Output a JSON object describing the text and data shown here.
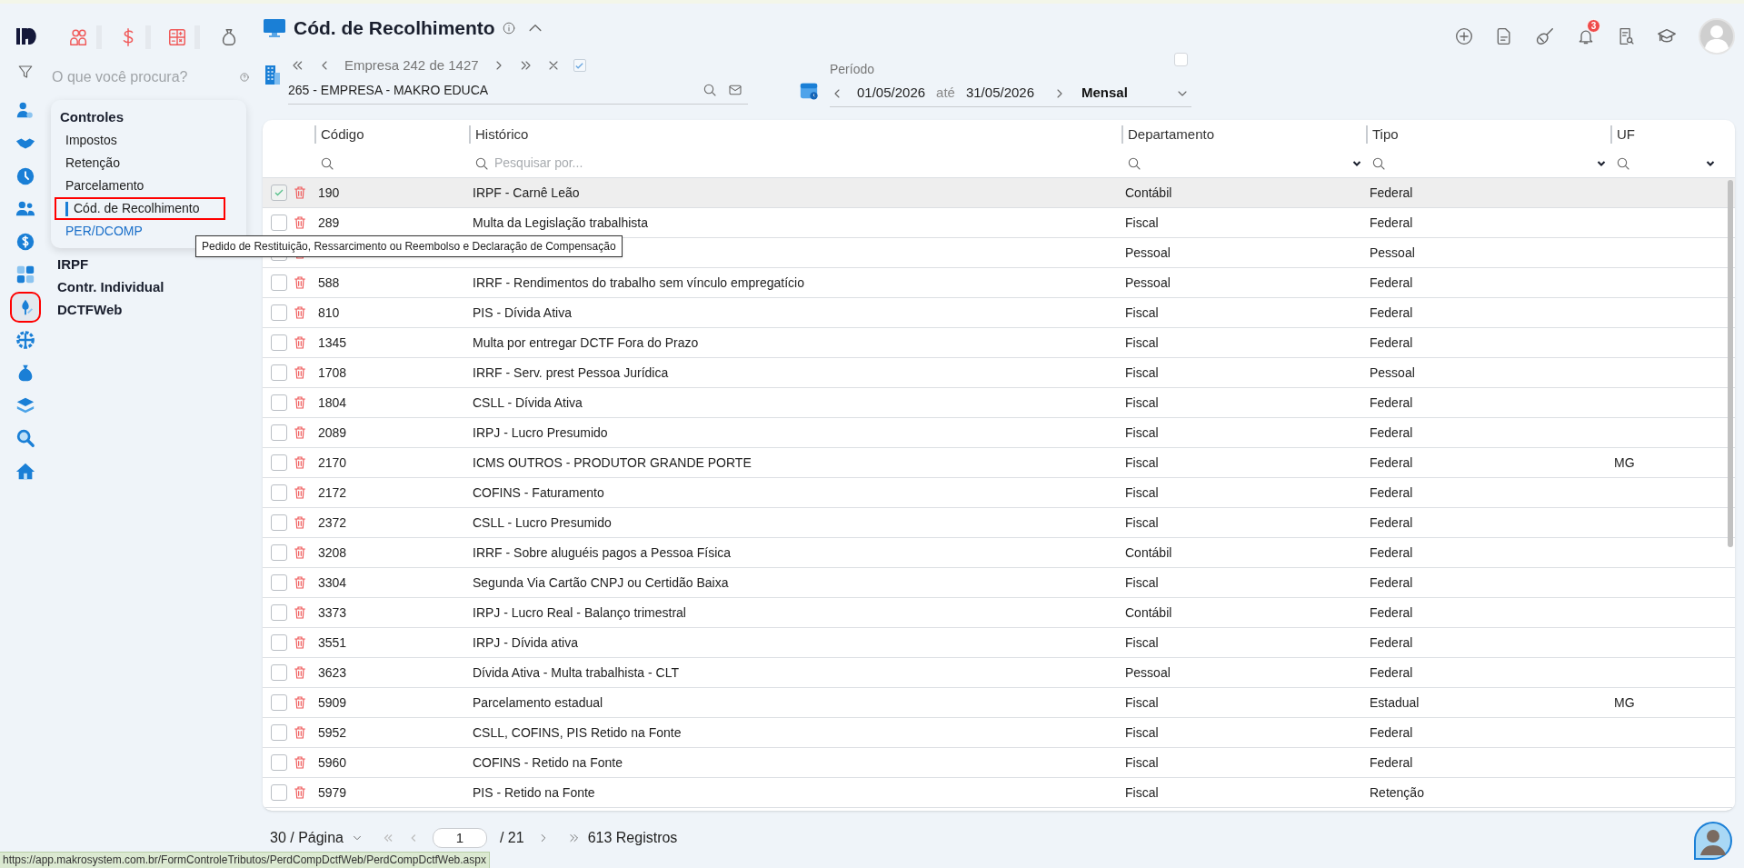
{
  "nav_rail": [
    {
      "selected": false
    },
    {
      "selected": false
    },
    {
      "selected": false
    },
    {
      "selected": false
    },
    {
      "selected": false
    },
    {
      "selected": false
    },
    {
      "selected": true
    },
    {
      "selected": false
    },
    {
      "selected": false
    },
    {
      "selected": false
    },
    {
      "selected": false
    },
    {
      "selected": false
    }
  ],
  "search": {
    "placeholder": "O que você procura?"
  },
  "menu": {
    "title": "Controles",
    "items": [
      {
        "label": "Impostos",
        "selected": false,
        "hovered": false
      },
      {
        "label": "Retenção",
        "selected": false,
        "hovered": false
      },
      {
        "label": "Parcelamento",
        "selected": false,
        "hovered": false
      },
      {
        "label": "Cód. de Recolhimento",
        "selected": true,
        "hovered": false
      },
      {
        "label": "PER/DCOMP",
        "selected": false,
        "hovered": true
      }
    ],
    "sections": [
      "IRPF",
      "Contr. Individual",
      "DCTFWeb"
    ]
  },
  "tooltip": "Pedido de Restituição, Ressarcimento ou Reembolso e Declaração de Compensação",
  "page": {
    "title": "Cód. de Recolhimento"
  },
  "company_nav": {
    "position": "Empresa 242 de 1427",
    "company": "265 - EMPRESA - MAKRO EDUCA",
    "filter_checked": true
  },
  "period": {
    "label": "Período",
    "from": "01/05/2026",
    "separator": "até",
    "to": "31/05/2026",
    "mode": "Mensal",
    "checked": false
  },
  "notifications": {
    "count": "3"
  },
  "table": {
    "columns": [
      "Código",
      "Histórico",
      "Departamento",
      "Tipo",
      "UF"
    ],
    "search_placeholder": "Pesquisar por...",
    "rows": [
      {
        "checked": true,
        "selected": true,
        "codigo": "190",
        "historico": "IRPF - Carnê Leão",
        "departamento": "Contábil",
        "tipo": "Federal",
        "uf": ""
      },
      {
        "checked": false,
        "selected": false,
        "codigo": "289",
        "historico": "Multa da Legislação trabalhista",
        "departamento": "Fiscal",
        "tipo": "Federal",
        "uf": ""
      },
      {
        "selected": false,
        "codigo": "",
        "historico": "",
        "departamento": "Pessoal",
        "tipo": "Pessoal",
        "uf": ""
      },
      {
        "checked": false,
        "selected": false,
        "codigo": "588",
        "historico": "IRRF - Rendimentos do trabalho sem vínculo empregatício",
        "departamento": "Pessoal",
        "tipo": "Federal",
        "uf": ""
      },
      {
        "checked": false,
        "selected": false,
        "codigo": "810",
        "historico": "PIS - Dívida Ativa",
        "departamento": "Fiscal",
        "tipo": "Federal",
        "uf": ""
      },
      {
        "checked": false,
        "selected": false,
        "codigo": "1345",
        "historico": "Multa por entregar DCTF Fora do Prazo",
        "departamento": "Fiscal",
        "tipo": "Federal",
        "uf": ""
      },
      {
        "checked": false,
        "selected": false,
        "codigo": "1708",
        "historico": "IRRF - Serv. prest Pessoa Jurídica",
        "departamento": "Fiscal",
        "tipo": "Pessoal",
        "uf": ""
      },
      {
        "checked": false,
        "selected": false,
        "codigo": "1804",
        "historico": "CSLL - Dívida Ativa",
        "departamento": "Fiscal",
        "tipo": "Federal",
        "uf": ""
      },
      {
        "checked": false,
        "selected": false,
        "codigo": "2089",
        "historico": "IRPJ - Lucro Presumido",
        "departamento": "Fiscal",
        "tipo": "Federal",
        "uf": ""
      },
      {
        "checked": false,
        "selected": false,
        "codigo": "2170",
        "historico": "ICMS OUTROS - PRODUTOR GRANDE PORTE",
        "departamento": "Fiscal",
        "tipo": "Federal",
        "uf": "MG"
      },
      {
        "checked": false,
        "selected": false,
        "codigo": "2172",
        "historico": "COFINS - Faturamento",
        "departamento": "Fiscal",
        "tipo": "Federal",
        "uf": ""
      },
      {
        "checked": false,
        "selected": false,
        "codigo": "2372",
        "historico": "CSLL - Lucro Presumido",
        "departamento": "Fiscal",
        "tipo": "Federal",
        "uf": ""
      },
      {
        "checked": false,
        "selected": false,
        "codigo": "3208",
        "historico": "IRRF - Sobre aluguéis pagos a Pessoa Física",
        "departamento": "Contábil",
        "tipo": "Federal",
        "uf": ""
      },
      {
        "checked": false,
        "selected": false,
        "codigo": "3304",
        "historico": "Segunda Via Cartão CNPJ ou Certidão Baixa",
        "departamento": "Fiscal",
        "tipo": "Federal",
        "uf": ""
      },
      {
        "checked": false,
        "selected": false,
        "codigo": "3373",
        "historico": "IRPJ - Lucro Real - Balanço trimestral",
        "departamento": "Contábil",
        "tipo": "Federal",
        "uf": ""
      },
      {
        "checked": false,
        "selected": false,
        "codigo": "3551",
        "historico": "IRPJ - Dívida ativa",
        "departamento": "Fiscal",
        "tipo": "Federal",
        "uf": ""
      },
      {
        "checked": false,
        "selected": false,
        "codigo": "3623",
        "historico": "Dívida Ativa - Multa trabalhista - CLT",
        "departamento": "Pessoal",
        "tipo": "Federal",
        "uf": ""
      },
      {
        "checked": false,
        "selected": false,
        "codigo": "5909",
        "historico": "Parcelamento estadual",
        "departamento": "Fiscal",
        "tipo": "Estadual",
        "uf": "MG"
      },
      {
        "checked": false,
        "selected": false,
        "codigo": "5952",
        "historico": "CSLL, COFINS, PIS Retido na Fonte",
        "departamento": "Fiscal",
        "tipo": "Federal",
        "uf": ""
      },
      {
        "checked": false,
        "selected": false,
        "codigo": "5960",
        "historico": "COFINS - Retido na Fonte",
        "departamento": "Fiscal",
        "tipo": "Federal",
        "uf": ""
      },
      {
        "checked": false,
        "selected": false,
        "codigo": "5979",
        "historico": "PIS - Retido na Fonte",
        "departamento": "Fiscal",
        "tipo": "Retenção",
        "uf": ""
      }
    ]
  },
  "pagination": {
    "page_size": "30 / Página",
    "page": "1",
    "total_pages": "/ 21",
    "records": "613 Registros"
  },
  "status_url": "https://app.makrosystem.com.br/FormControleTributos/PerdCompDctfWeb/PerdCompDctfWeb.aspx"
}
